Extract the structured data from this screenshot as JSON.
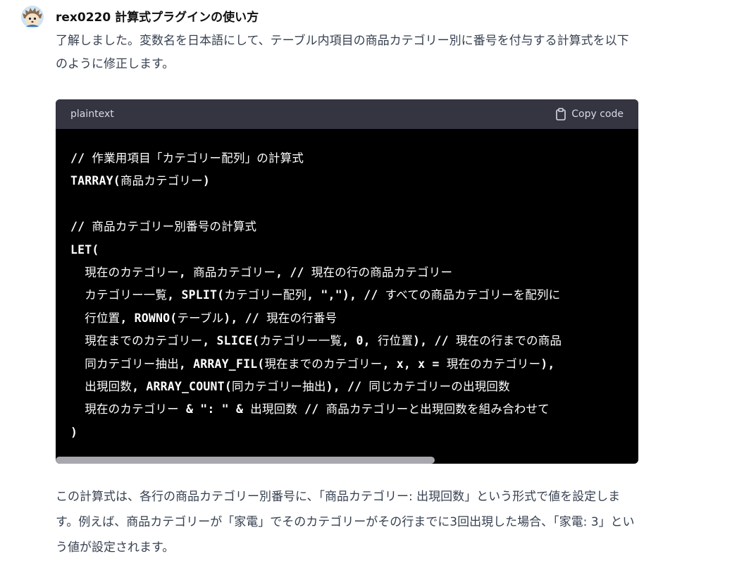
{
  "message": {
    "author": "rex0220 計算式プラグインの使い方",
    "intro": "了解しました。変数名を日本語にして、テーブル内項目の商品カテゴリー別に番号を付与する計算式を以下のように修正します。",
    "outro": "この計算式は、各行の商品カテゴリー別番号に、「商品カテゴリー: 出現回数」という形式で値を設定します。例えば、商品カテゴリーが「家電」でそのカテゴリーがその行までに3回出現した場合、「家電: 3」という値が設定されます。"
  },
  "code_block": {
    "language": "plaintext",
    "copy_label": "Copy code",
    "lines": [
      "// 作業用項目「カテゴリー配列」の計算式",
      "TARRAY(商品カテゴリー)",
      "",
      "// 商品カテゴリー別番号の計算式",
      "LET(",
      "  現在のカテゴリー, 商品カテゴリー, // 現在の行の商品カテゴリー",
      "  カテゴリー一覧, SPLIT(カテゴリー配列, \",\"), // すべての商品カテゴリーを配列に",
      "  行位置, ROWNO(テーブル), // 現在の行番号",
      "  現在までのカテゴリー, SLICE(カテゴリー一覧, 0, 行位置), // 現在の行までの商品",
      "  同カテゴリー抽出, ARRAY_FIL(現在までのカテゴリー, x, x = 現在のカテゴリー),",
      "  出現回数, ARRAY_COUNT(同カテゴリー抽出), // 同じカテゴリーの出現回数",
      "  現在のカテゴリー & \": \" & 出現回数 // 商品カテゴリーと出現回数を組み合わせて",
      ")"
    ]
  },
  "icons": {
    "avatar": "hedgehog-avatar",
    "copy": "clipboard-icon"
  },
  "colors": {
    "code_background": "#000000",
    "code_header": "#343541",
    "text": "#374151"
  }
}
